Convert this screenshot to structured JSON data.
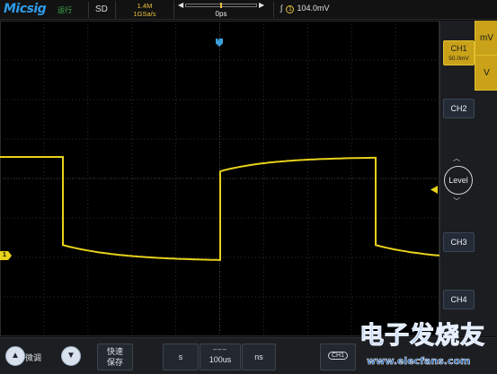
{
  "topbar": {
    "brand": "Micsig",
    "run_state": "运行",
    "mode": "SD",
    "memory_depth": "1.4M",
    "sample_rate": "1GSa/s",
    "horizontal_delay": "0ps",
    "trigger_source": "1",
    "trigger_level": "104.0mV"
  },
  "screen": {
    "trigger_marker": "T",
    "ch1_marker": "1"
  },
  "rightpanel": {
    "unit_up": "mV",
    "unit_down": "V",
    "ch1_label": "CH1",
    "ch1_scale": "50.0mV",
    "ch2_label": "CH2",
    "ch3_label": "CH3",
    "ch4_label": "CH4",
    "level_label": "Level"
  },
  "bottombar": {
    "fine_label": "微调",
    "save_line1": "快速",
    "save_line2": "保存",
    "timebase_left_unit": "s",
    "timebase_value": "100us",
    "timebase_right_unit": "ns",
    "source_chip": "CH1"
  },
  "watermark": {
    "big": "电子发烧友",
    "url": "www.elecfans.com"
  },
  "colors": {
    "ch1": "#e8d21a",
    "accent_blue": "#2f9be8",
    "panel": "#1b1d20"
  },
  "waveform": {
    "type": "square",
    "color": "#e8d21a",
    "high_level_divisions": 1.0,
    "low_level_divisions": -1.0,
    "shape": "square wave with exponential droop on both high and low plateaus"
  }
}
